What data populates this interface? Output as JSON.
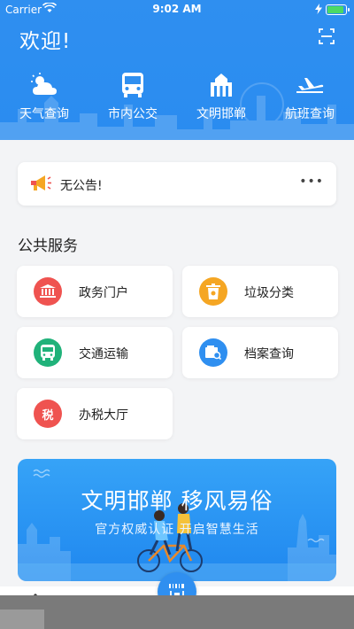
{
  "status_bar": {
    "carrier": "Carrier",
    "time": "9:02 AM"
  },
  "header": {
    "welcome": "欢迎!",
    "quick_links": [
      {
        "label": "天气查询",
        "icon": "cloud-sun-icon"
      },
      {
        "label": "市内公交",
        "icon": "bus-icon"
      },
      {
        "label": "文明邯郸",
        "icon": "landmark-icon"
      },
      {
        "label": "航班查询",
        "icon": "airplane-icon"
      }
    ]
  },
  "notice": {
    "text": "无公告!",
    "more": "•••"
  },
  "public_services": {
    "title": "公共服务",
    "items": [
      {
        "label": "政务门户",
        "icon": "government-icon",
        "color": "#ef5350"
      },
      {
        "label": "垃圾分类",
        "icon": "trash-bin-icon",
        "color": "#f5a623"
      },
      {
        "label": "交通运输",
        "icon": "bus-icon",
        "color": "#20b27a"
      },
      {
        "label": "档案查询",
        "icon": "archive-icon",
        "color": "#2f8ff0"
      },
      {
        "label": "办税大厅",
        "icon": "tax-icon",
        "color": "#ef5350",
        "glyph": "税"
      }
    ]
  },
  "banner": {
    "title": "文明邯郸  移风易俗",
    "subtitle": "官方权威认证  开启智慧生活"
  },
  "colors": {
    "primary": "#2f8ff0",
    "background": "#f3f4f6"
  }
}
